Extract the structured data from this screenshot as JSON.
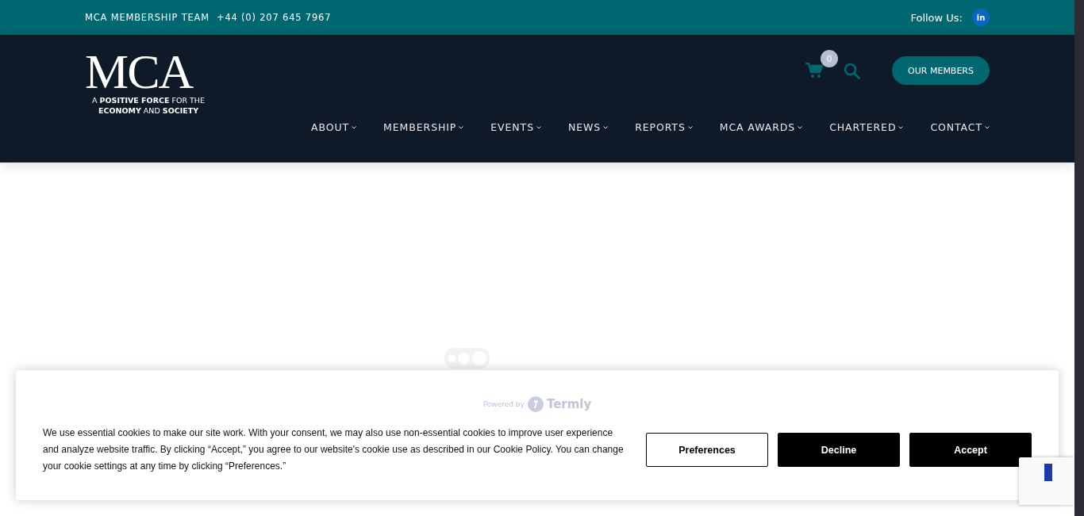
{
  "top_bar": {
    "team": "MCA MEMBERSHIP TEAM",
    "phone": "+44 (0) 207 645 7967",
    "follow_label": "Follow Us:",
    "social": "in"
  },
  "header": {
    "logo": "MCA",
    "tagline": "A **POSITIVE FORCE** FOR THE **ECONOMY** AND **SOCIETY**",
    "cart_count": "0",
    "members_button": "OUR MEMBERS"
  },
  "nav": [
    {
      "label": "ABOUT"
    },
    {
      "label": "MEMBERSHIP"
    },
    {
      "label": "EVENTS"
    },
    {
      "label": "NEWS"
    },
    {
      "label": "REPORTS"
    },
    {
      "label": "MCA AWARDS"
    },
    {
      "label": "CHARTERED"
    },
    {
      "label": "CONTACT"
    }
  ],
  "cookie_banner": {
    "powered_by": "Powered by",
    "brand": "Termly",
    "message": "We use essential cookies to make our site work. With your consent, we may also use non-essential cookies to improve user experience and analyze website traffic. By clicking “Accept,” you agree to our website's cookie use as described in our Cookie Policy. You can change your cookie settings at any time by clicking “Preferences.”",
    "buttons": [
      {
        "label": "Preferences",
        "kind": "outline"
      },
      {
        "label": "Decline",
        "kind": "solid"
      },
      {
        "label": "Accept",
        "kind": "solid"
      }
    ]
  }
}
